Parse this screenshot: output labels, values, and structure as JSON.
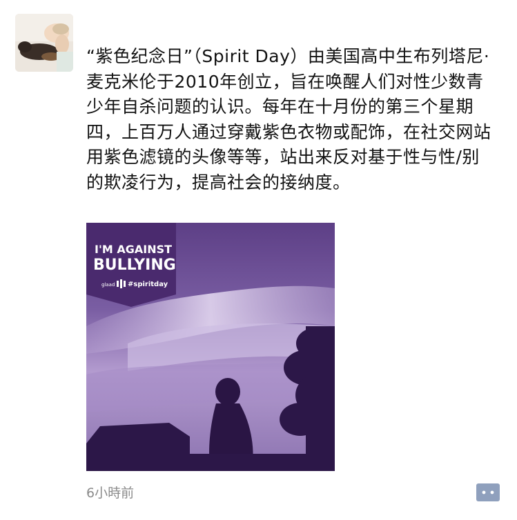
{
  "post": {
    "text": "“紫色纪念日”（Spirit Day）由美国高中生布列塔尼·麦克米伦于2010年创立，旨在唤醒人们对性少数青少年自杀问题的认识。每年在十月份的第三个星期四，上百万人通过穿戴紫色衣物或配饰，在社交网站用紫色滤镜的头像等等，站出来反对基于性与性/别的欺凌行为，提高社会的接纳度。",
    "timestamp": "6小時前"
  },
  "image": {
    "badge_line1": "I'M AGAINST",
    "badge_line2": "BULLYING",
    "badge_brand": "glaad",
    "badge_hashtag": "#spiritday"
  },
  "icons": {
    "comment": "comment-icon"
  },
  "colors": {
    "purple_dark": "#4a2a6e",
    "purple_mid": "#6b4f92",
    "purple_light": "#b79fd3"
  }
}
